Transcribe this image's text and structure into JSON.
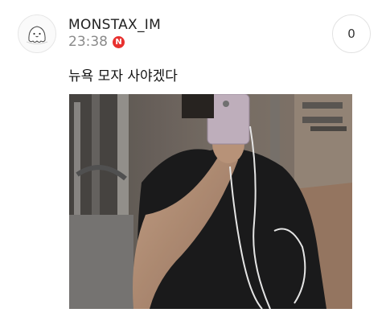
{
  "post": {
    "username": "MONSTAX_IM",
    "time": "23:38",
    "new_badge": "N",
    "comment_count": "0",
    "text": "뉴욕 모자 사야겠다"
  },
  "icons": {
    "avatar": "ghost-avatar-icon",
    "badge": "new-badge-icon"
  },
  "colors": {
    "badge": "#e8312f",
    "time": "#8a8a8a"
  }
}
